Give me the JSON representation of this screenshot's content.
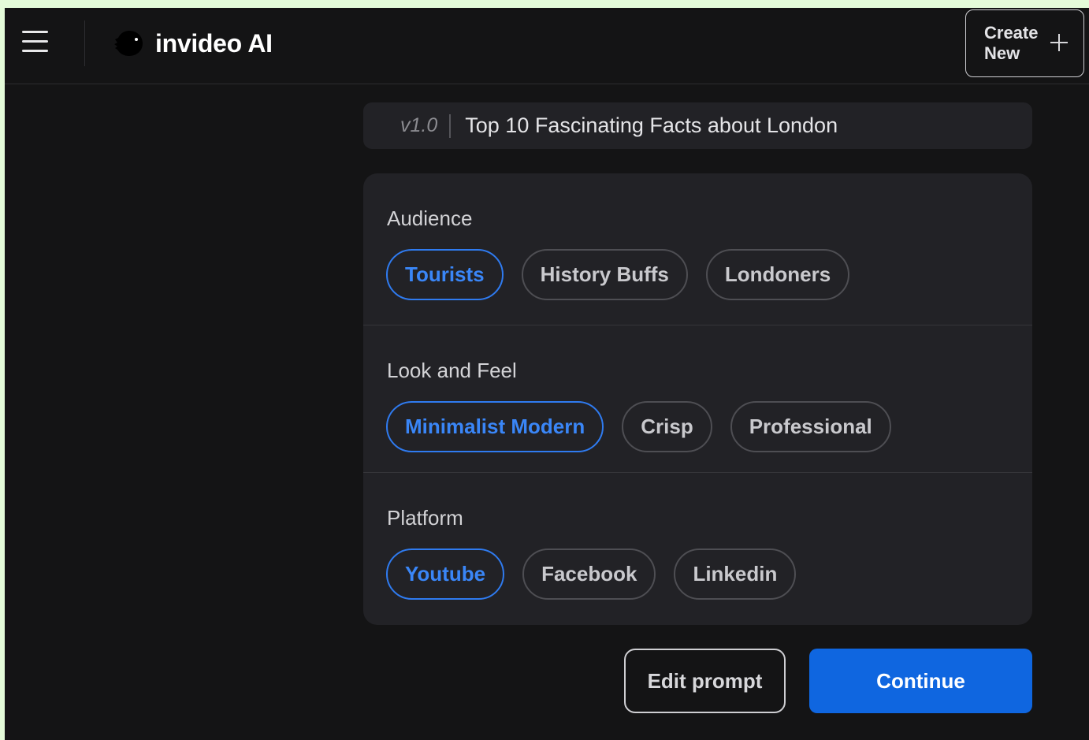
{
  "app": {
    "name": "invideo AI",
    "create_button_label": "Create New"
  },
  "prompt": {
    "version": "v1.0",
    "title": "Top 10 Fascinating Facts about London"
  },
  "sections": [
    {
      "label": "Audience",
      "options": [
        {
          "label": "Tourists",
          "selected": true
        },
        {
          "label": "History Buffs",
          "selected": false
        },
        {
          "label": "Londoners",
          "selected": false
        }
      ]
    },
    {
      "label": "Look and Feel",
      "options": [
        {
          "label": "Minimalist Modern",
          "selected": true
        },
        {
          "label": "Crisp",
          "selected": false
        },
        {
          "label": "Professional",
          "selected": false
        }
      ]
    },
    {
      "label": "Platform",
      "options": [
        {
          "label": "Youtube",
          "selected": true
        },
        {
          "label": "Facebook",
          "selected": false
        },
        {
          "label": "Linkedin",
          "selected": false
        }
      ]
    }
  ],
  "actions": {
    "edit_prompt": "Edit prompt",
    "continue": "Continue"
  },
  "icons": {
    "menu": "hamburger-menu-icon",
    "logo": "invideo-logo-icon",
    "plus": "plus-icon"
  },
  "colors": {
    "background": "#141415",
    "panel": "#222226",
    "accent": "#0f66e0",
    "selected_chip": "#3a86f7",
    "outer_frame": "#e4fbd9"
  }
}
